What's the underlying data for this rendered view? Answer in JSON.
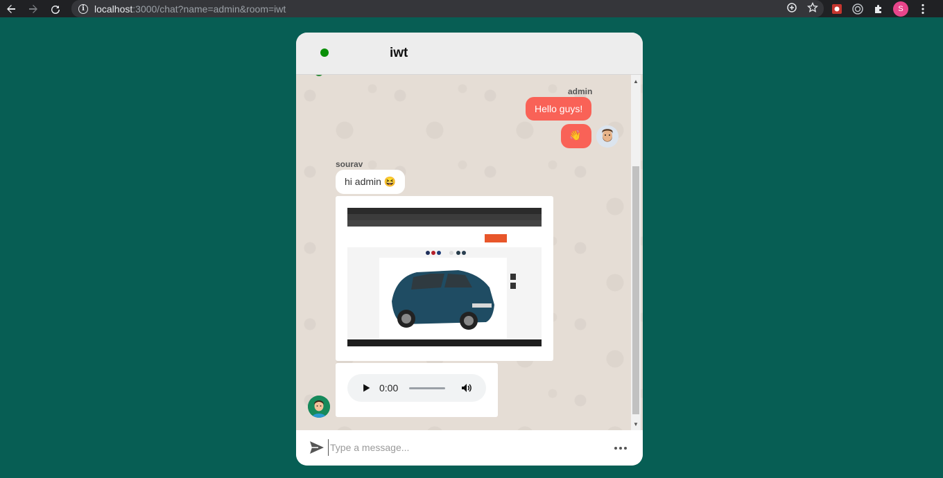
{
  "browser": {
    "url_host": "localhost",
    "url_rest": ":3000/chat?name=admin&room=iwt",
    "profile_initial": "S"
  },
  "chat": {
    "room_name": "iwt",
    "online_color": "#0a8f08",
    "messages": [
      {
        "sender": "admin",
        "text": "Hello guys!",
        "direction": "outgoing"
      },
      {
        "sender": "admin",
        "text": "👋",
        "direction": "outgoing"
      },
      {
        "sender": "sourav",
        "text": "hi admin 😆",
        "direction": "incoming"
      },
      {
        "sender": "sourav",
        "type": "image",
        "description_icon": "car-screenshot"
      },
      {
        "sender": "sourav",
        "type": "audio",
        "time": "0:00"
      }
    ]
  },
  "composer": {
    "placeholder": "Type a message..."
  },
  "colors": {
    "background": "#075e54",
    "outgoing_bubble": "#f96257",
    "incoming_bubble": "#ffffff"
  }
}
